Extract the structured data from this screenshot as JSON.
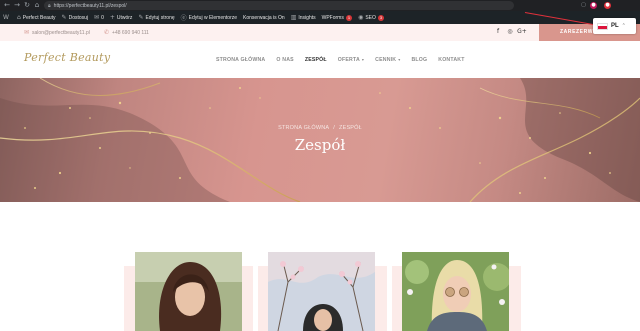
{
  "browser": {
    "back": "←",
    "forward": "→",
    "reload": "↻",
    "home": "⌂",
    "url": "https://perfectbeauty11.pl/zespol/",
    "lock_icon": "lock-icon",
    "extensions": [
      "extension-icon",
      "star-icon",
      "profile-icon"
    ]
  },
  "wp_admin": {
    "items": [
      {
        "icon": "W",
        "label": ""
      },
      {
        "icon": "⌂",
        "label": "Perfect Beauty"
      },
      {
        "icon": "✎",
        "label": "Dostosuj"
      },
      {
        "icon": "✉",
        "label": "0"
      },
      {
        "icon": "+",
        "label": "Utwórz"
      },
      {
        "icon": "✎",
        "label": "Edytuj stronę"
      },
      {
        "icon": "ⓔ",
        "label": "Edytuj w Elementorze"
      },
      {
        "icon": "",
        "label": "Konserwacja is On"
      },
      {
        "icon": "▥",
        "label": "Insights"
      },
      {
        "icon": "",
        "label": "WPForms",
        "badge": "1"
      },
      {
        "icon": "◉",
        "label": "SEO",
        "badge": "3"
      }
    ]
  },
  "topbar": {
    "email": "salon@perfectbeauty11.pl",
    "phone": "+48 690 940 111",
    "social": [
      "f",
      "◎",
      "G+"
    ],
    "book_button": "ZAREZERWUJ WIZYTĘ"
  },
  "language": {
    "code": "PL",
    "chevron": "⌃"
  },
  "header": {
    "logo": "Perfect Beauty",
    "menu": [
      {
        "label": "STRONA GŁÓWNA",
        "active": false,
        "dropdown": false
      },
      {
        "label": "O NAS",
        "active": false,
        "dropdown": false
      },
      {
        "label": "ZESPÓŁ",
        "active": true,
        "dropdown": false
      },
      {
        "label": "OFERTA",
        "active": false,
        "dropdown": true
      },
      {
        "label": "CENNIK",
        "active": false,
        "dropdown": true
      },
      {
        "label": "BLOG",
        "active": false,
        "dropdown": false
      },
      {
        "label": "KONTAKT",
        "active": false,
        "dropdown": false
      }
    ]
  },
  "hero": {
    "breadcrumb_home": "STRONA GŁÓWNA",
    "breadcrumb_sep": "/",
    "breadcrumb_current": "ZESPÓŁ",
    "title": "Zespół"
  },
  "colors": {
    "accent": "#d9968d",
    "gold": "#b39a5d",
    "annotation_red": "#e0313b"
  }
}
